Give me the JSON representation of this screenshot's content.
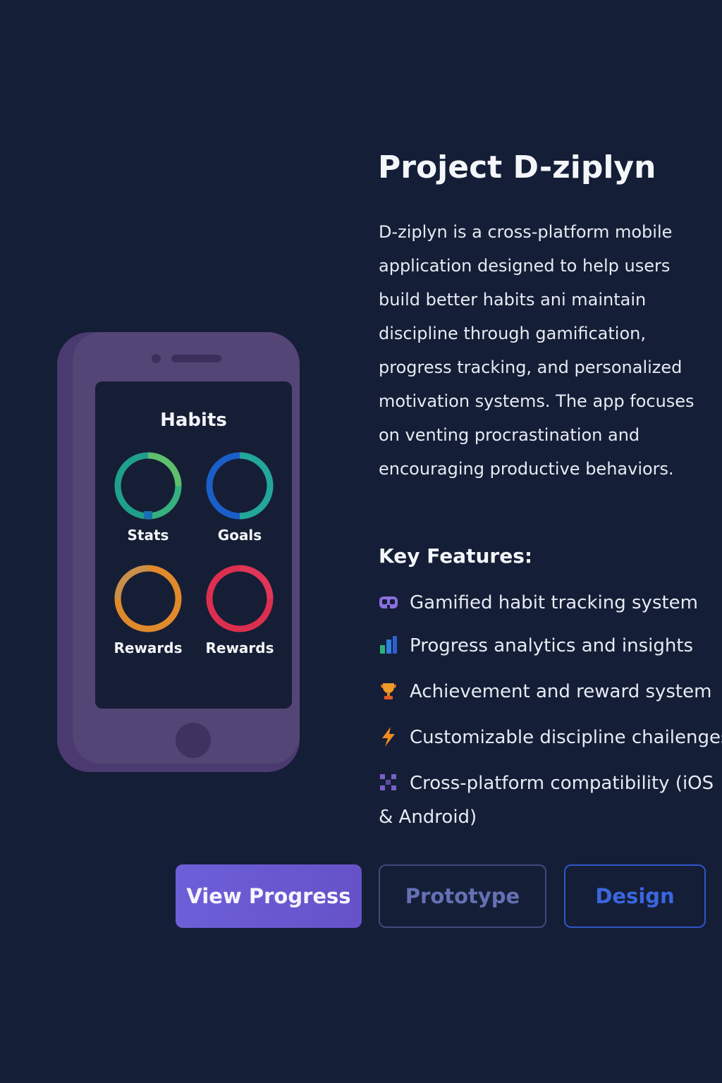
{
  "phone": {
    "screen_title": "Habits",
    "rings": [
      {
        "label": "Stats",
        "colors": [
          "#1fa08c",
          "#5fbf6c",
          "#1a6fb0"
        ]
      },
      {
        "label": "Goals",
        "colors": [
          "#1a5fc8",
          "#22a79a"
        ]
      },
      {
        "label": "Rewards",
        "colors": [
          "#e08a2c",
          "#c9904a"
        ]
      },
      {
        "label": "Rewards",
        "colors": [
          "#dc2f4f",
          "#e0365a"
        ]
      }
    ]
  },
  "project": {
    "title": "Project D-ziplyn",
    "description": "D-ziplyn is a cross-platform mobile application designed to help users build better habits ani maintain discipline through gamification, progress tracking, and personalized motivation systems. The app focuses on venting procrastination and encouraging productive behaviors."
  },
  "features": {
    "heading": "Key Features:",
    "items": [
      {
        "icon": "gamepad-icon",
        "label": "Gamified habit  tracking system"
      },
      {
        "icon": "bar-chart-icon",
        "label": "Progress analytics and insights"
      },
      {
        "icon": "trophy-icon",
        "label": "Achievement and reward system"
      },
      {
        "icon": "lightning-icon",
        "label": "Customizable discipline chailenges"
      },
      {
        "icon": "checker-grid-icon",
        "label": "Cross-platform compatibility (iOS & Android)"
      }
    ]
  },
  "buttons": {
    "view_progress": "View Progress",
    "prototype": "Prototype",
    "design": "Design"
  },
  "colors": {
    "background": "#141e36",
    "primary_button": "#6a5bd4",
    "design_accent": "#3b66e0"
  }
}
